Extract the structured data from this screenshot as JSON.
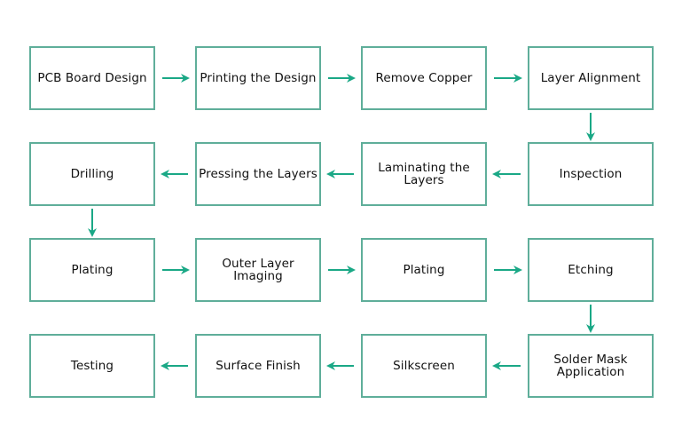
{
  "diagram": {
    "type": "flowchart",
    "colors": {
      "border": "#5fae9a",
      "arrow": "#1aa886",
      "text": "#111111"
    },
    "steps": [
      {
        "id": 1,
        "label": "PCB Board Design"
      },
      {
        "id": 2,
        "label": "Printing the Design"
      },
      {
        "id": 3,
        "label": "Remove Copper"
      },
      {
        "id": 4,
        "label": "Layer Alignment"
      },
      {
        "id": 5,
        "label": "Inspection"
      },
      {
        "id": 6,
        "label": "Laminating the Layers"
      },
      {
        "id": 7,
        "label": "Pressing the Layers"
      },
      {
        "id": 8,
        "label": "Drilling"
      },
      {
        "id": 9,
        "label": "Plating"
      },
      {
        "id": 10,
        "label": "Outer Layer Imaging"
      },
      {
        "id": 11,
        "label": "Plating"
      },
      {
        "id": 12,
        "label": "Etching"
      },
      {
        "id": 13,
        "label": "Solder Mask Application"
      },
      {
        "id": 14,
        "label": "Silkscreen"
      },
      {
        "id": 15,
        "label": "Surface Finish"
      },
      {
        "id": 16,
        "label": "Testing"
      }
    ],
    "flow": [
      [
        1,
        2
      ],
      [
        2,
        3
      ],
      [
        3,
        4
      ],
      [
        4,
        5
      ],
      [
        5,
        6
      ],
      [
        6,
        7
      ],
      [
        7,
        8
      ],
      [
        8,
        9
      ],
      [
        9,
        10
      ],
      [
        10,
        11
      ],
      [
        11,
        12
      ],
      [
        12,
        13
      ],
      [
        13,
        14
      ],
      [
        14,
        15
      ],
      [
        15,
        16
      ]
    ]
  }
}
